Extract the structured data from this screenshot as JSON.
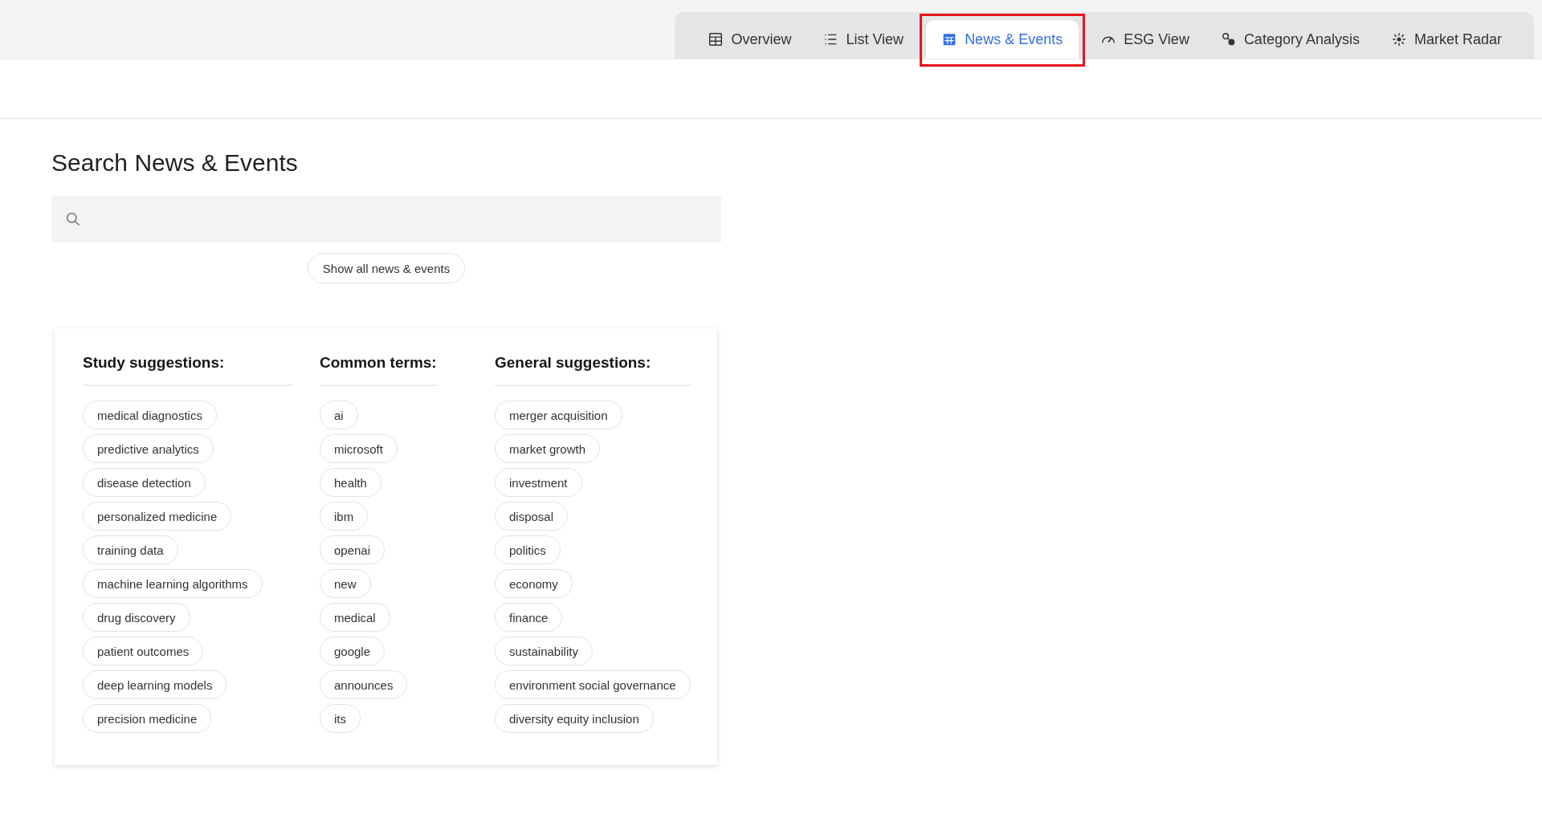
{
  "tabs": [
    {
      "label": "Overview",
      "selected": false,
      "highlighted": false
    },
    {
      "label": "List View",
      "selected": false,
      "highlighted": false
    },
    {
      "label": "News & Events",
      "selected": true,
      "highlighted": true
    },
    {
      "label": "ESG View",
      "selected": false,
      "highlighted": false
    },
    {
      "label": "Category Analysis",
      "selected": false,
      "highlighted": false
    },
    {
      "label": "Market Radar",
      "selected": false,
      "highlighted": false
    }
  ],
  "heading": "Search News & Events",
  "show_all_button": "Show all news & events",
  "suggestions": [
    {
      "title": "Study suggestions:",
      "terms": [
        "medical diagnostics",
        "predictive analytics",
        "disease detection",
        "personalized medicine",
        "training data",
        "machine learning algorithms",
        "drug discovery",
        "patient outcomes",
        "deep learning models",
        "precision medicine"
      ]
    },
    {
      "title": "Common terms:",
      "terms": [
        "ai",
        "microsoft",
        "health",
        "ibm",
        "openai",
        "new",
        "medical",
        "google",
        "announces",
        "its"
      ]
    },
    {
      "title": "General suggestions:",
      "terms": [
        "merger acquisition",
        "market growth",
        "investment",
        "disposal",
        "politics",
        "economy",
        "finance",
        "sustainability",
        "environment social governance",
        "diversity equity inclusion"
      ]
    }
  ]
}
